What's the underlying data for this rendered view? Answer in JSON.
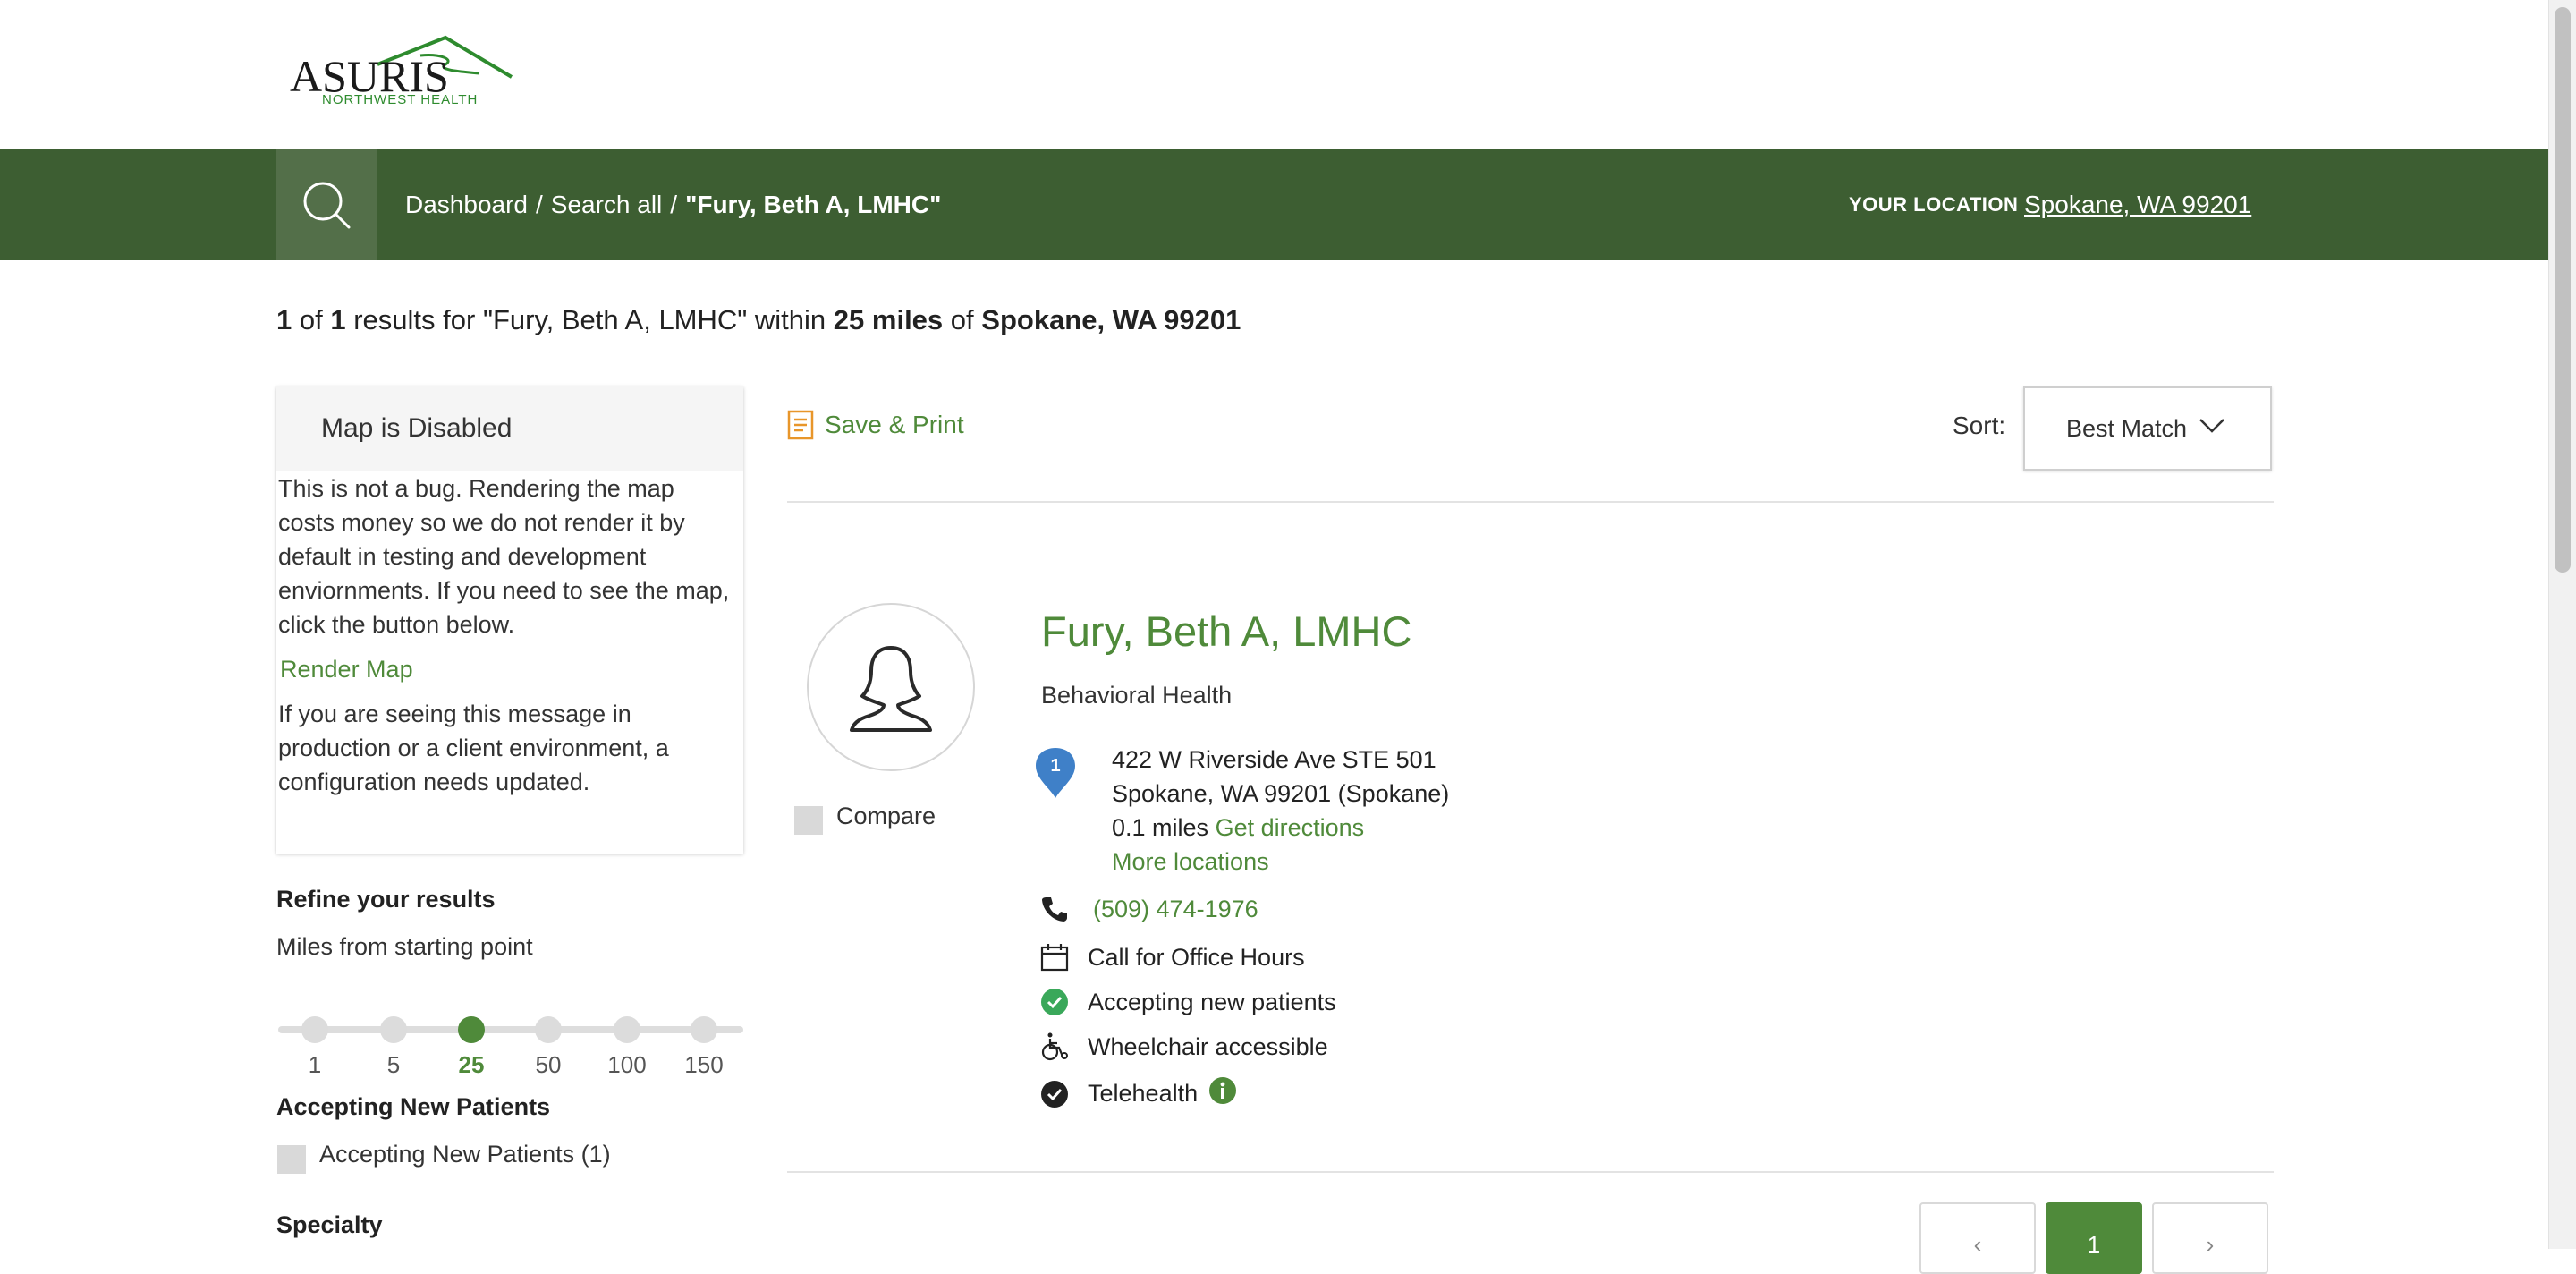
{
  "logo": {
    "wordmark": "ASURIS",
    "tagline": "NORTHWEST HEALTH",
    "brand_color": "#2e8b2e"
  },
  "header": {
    "breadcrumb": {
      "dashboard": "Dashboard",
      "search_all": "Search all",
      "separator": "/",
      "current": "\"Fury, Beth A, LMHC\""
    },
    "location_label": "YOUR LOCATION",
    "location_value": "Spokane, WA 99201",
    "nav_color": "#3d5e32"
  },
  "summary": {
    "count": "1",
    "of": "of",
    "total": "1",
    "results_for": "results for \"Fury, Beth A, LMHC\" within",
    "distance": "25 miles",
    "of_location": "of",
    "location": "Spokane, WA 99201"
  },
  "map_card": {
    "title": "Map is Disabled",
    "message": "This is not a bug. Rendering the map costs money so we do not render it by default in testing and development enviornments. If you need to see the map, click the button below.",
    "render_button": "Render Map",
    "footer_message": "If you are seeing this message in production or a client environment, a configuration needs updated."
  },
  "filters": {
    "refine_title": "Refine your results",
    "miles_label": "Miles from starting point",
    "miles_options": [
      "1",
      "5",
      "25",
      "50",
      "100",
      "150"
    ],
    "miles_selected": "25",
    "accepting_title": "Accepting New Patients",
    "accepting_option": "Accepting New Patients (1)",
    "specialty_title": "Specialty"
  },
  "toolbar": {
    "save_print": "Save & Print",
    "sort_label": "Sort:",
    "sort_value": "Best Match"
  },
  "result": {
    "name": "Fury, Beth A, LMHC",
    "specialty": "Behavioral Health",
    "pin_number": "1",
    "address_line1": "422 W Riverside Ave STE 501",
    "address_line2": "Spokane, WA 99201 (Spokane)",
    "distance": "0.1 miles",
    "directions": "Get directions",
    "more_locations": "More locations",
    "phone": "(509) 474-1976",
    "office_hours": "Call for Office Hours",
    "accepting": "Accepting new patients",
    "wheelchair": "Wheelchair accessible",
    "telehealth": "Telehealth",
    "compare_label": "Compare"
  },
  "pagination": {
    "prev": "‹",
    "current": "1",
    "next": "›"
  },
  "colors": {
    "accent_green": "#4f8a3a",
    "pin_blue": "#3f80c8"
  }
}
